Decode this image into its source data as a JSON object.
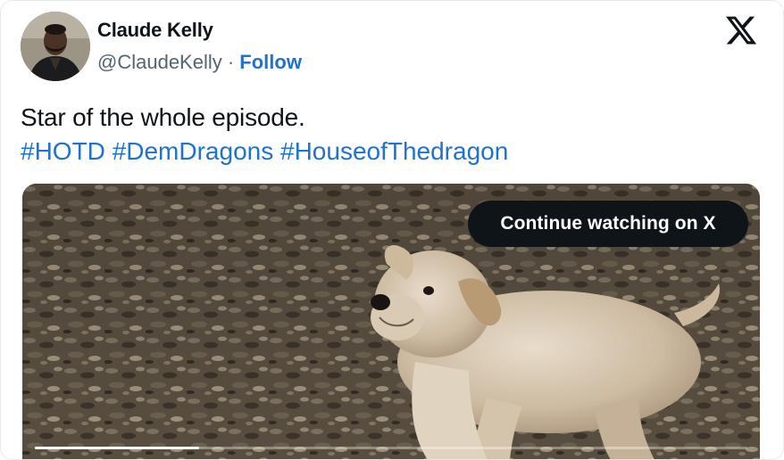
{
  "author": {
    "name": "Claude Kelly",
    "handle": "@ClaudeKelly",
    "separator": " · ",
    "follow_label": "Follow"
  },
  "tweet": {
    "text": "Star of the whole episode.",
    "hashtags": [
      "#HOTD",
      "#DemDragons",
      "#HouseofThedragon"
    ]
  },
  "media": {
    "continue_label": "Continue watching on X",
    "progress": 0.23
  },
  "icons": {
    "brand": "x-logo-icon"
  },
  "colors": {
    "link": "#1d72d2",
    "text": "#0f1419",
    "secondary": "#536471"
  }
}
